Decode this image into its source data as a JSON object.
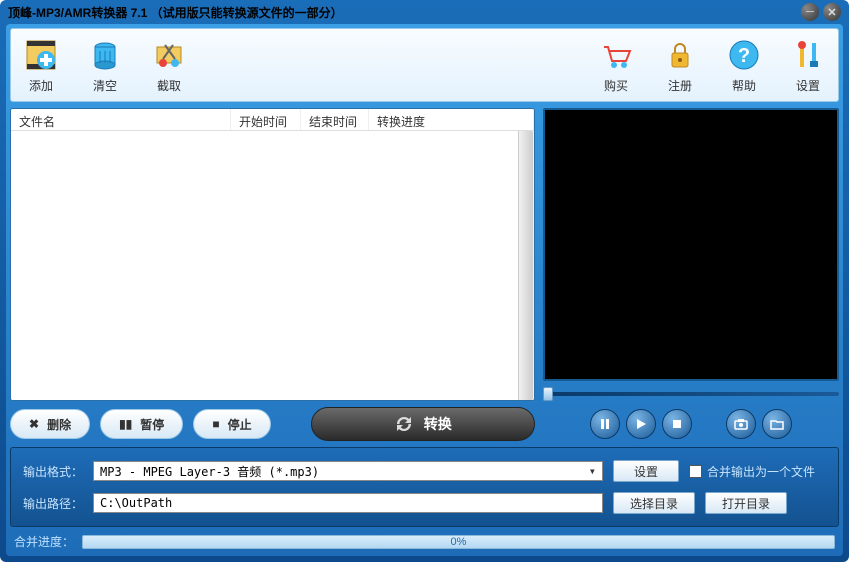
{
  "titlebar": {
    "title": "顶峰-MP3/AMR转换器 7.1 （试用版只能转换源文件的一部分）"
  },
  "toolbar": {
    "add": "添加",
    "clear": "清空",
    "cut": "截取",
    "buy": "购买",
    "register": "注册",
    "help": "帮助",
    "settings": "设置"
  },
  "filelist": {
    "cols": {
      "name": "文件名",
      "start": "开始时间",
      "end": "结束时间",
      "progress": "转换进度"
    }
  },
  "actions": {
    "delete": "删除",
    "pause": "暂停",
    "stop": "停止",
    "convert": "转换"
  },
  "output": {
    "format_label": "输出格式：",
    "format_value": "MP3 - MPEG Layer-3 音频 (*.mp3)",
    "settings_btn": "设置",
    "merge_label": "合并输出为一个文件",
    "path_label": "输出路径：",
    "path_value": "C:\\OutPath",
    "choose_btn": "选择目录",
    "open_btn": "打开目录"
  },
  "progress": {
    "label": "合并进度：",
    "percent": "0%"
  }
}
